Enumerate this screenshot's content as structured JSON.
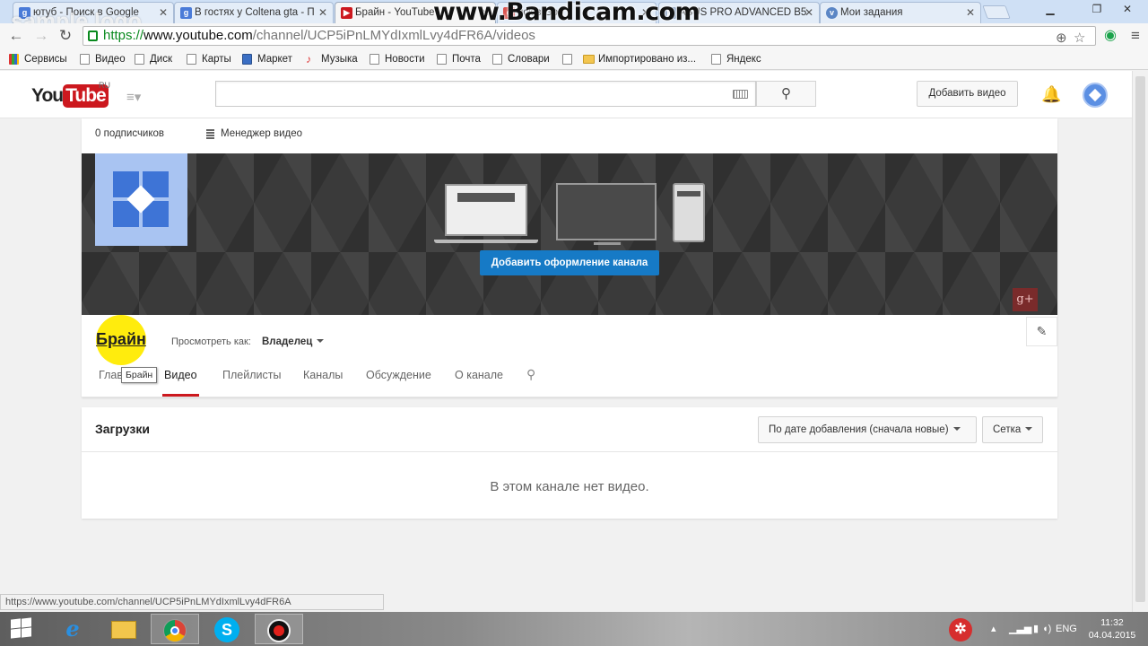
{
  "browser": {
    "tabs": [
      {
        "label": "ютуб - Поиск в Google",
        "fav": "g"
      },
      {
        "label": "В гостях у Coltena gta - П",
        "fav": "g"
      },
      {
        "label": "Брайн - YouTube",
        "fav": "yt"
      },
      {
        "label": "иск в Goo",
        "fav": "g"
      },
      {
        "label": "ASUS PRO ADVANCED B5",
        "fav": "doc"
      },
      {
        "label": "Мои задания",
        "fav": "v"
      }
    ],
    "url_scheme": "https://",
    "url_host": "www.youtube.com",
    "url_path": "/channel/UCP5iPnLMYdIxmlLvy4dFR6A/videos",
    "bookmarks": [
      "Сервисы",
      "Видео",
      "Диск",
      "Карты",
      "Маркет",
      "Музыка",
      "Новости",
      "Почта",
      "Словари",
      "Импортировано из...",
      "Яндекс"
    ],
    "status_url": "https://www.youtube.com/channel/UCP5iPnLMYdIxmlLvy4dFR6A"
  },
  "watermarks": {
    "bandicam": "www.Bandicam.com",
    "sample_logo": "sample logo"
  },
  "youtube": {
    "logo_you": "You",
    "logo_tube": "Tube",
    "logo_region": "RU",
    "search_placeholder": "",
    "upload_button": "Добавить видео",
    "subscribers": "0 подписчиков",
    "video_manager": "Менеджер видео",
    "add_channel_art": "Добавить оформление канала",
    "gplus": "g+",
    "channel_name": "Брайн",
    "view_as_label": "Просмотреть как:",
    "view_as_value": "Владелец",
    "tooltip": "Брайн",
    "tabs": {
      "home": "Глав",
      "videos": "Видео",
      "playlists": "Плейлисты",
      "channels": "Каналы",
      "discussion": "Обсуждение",
      "about": "О канале"
    },
    "uploads_title": "Загрузки",
    "sort_label": "По дате добавления (сначала новые)",
    "view_label": "Сетка",
    "empty_message": "В этом канале нет видео."
  },
  "taskbar": {
    "language": "ENG",
    "time": "11:32",
    "date": "04.04.2015"
  },
  "colors": {
    "yt_red": "#cc181e",
    "yt_blue": "#167ac6",
    "avatar_blue": "#3e74d6"
  }
}
